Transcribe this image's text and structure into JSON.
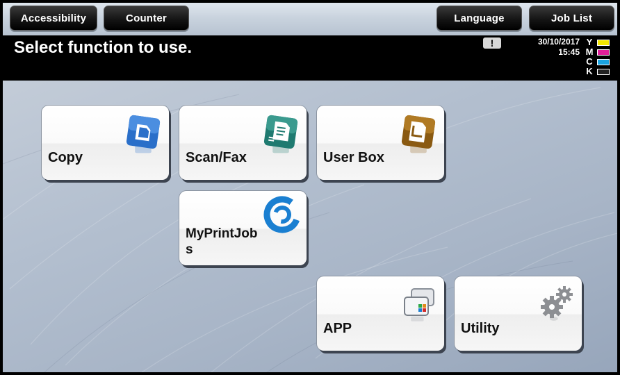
{
  "topbar": {
    "accessibility_label": "Accessibility",
    "counter_label": "Counter",
    "language_label": "Language",
    "joblist_label": "Job List"
  },
  "status": {
    "message": "Select function to use.",
    "alert_icon": "exclamation-icon",
    "alert_text": "!",
    "date": "30/10/2017",
    "time": "15:45",
    "toner": [
      {
        "letter": "Y",
        "color": "#f2e600"
      },
      {
        "letter": "M",
        "color": "#e0209a"
      },
      {
        "letter": "C",
        "color": "#1aa3e0"
      },
      {
        "letter": "K",
        "color": "#222222"
      }
    ]
  },
  "tiles": {
    "copy": {
      "label": "Copy",
      "icon": "copy-icon"
    },
    "scanfax": {
      "label": "Scan/Fax",
      "icon": "scan-fax-icon"
    },
    "userbox": {
      "label": "User Box",
      "icon": "user-box-icon"
    },
    "myprintjobs": {
      "label": "MyPrintJob s",
      "icon": "myprintjobs-icon"
    },
    "app": {
      "label": "APP",
      "icon": "app-icon"
    },
    "utility": {
      "label": "Utility",
      "icon": "gear-icon"
    }
  }
}
